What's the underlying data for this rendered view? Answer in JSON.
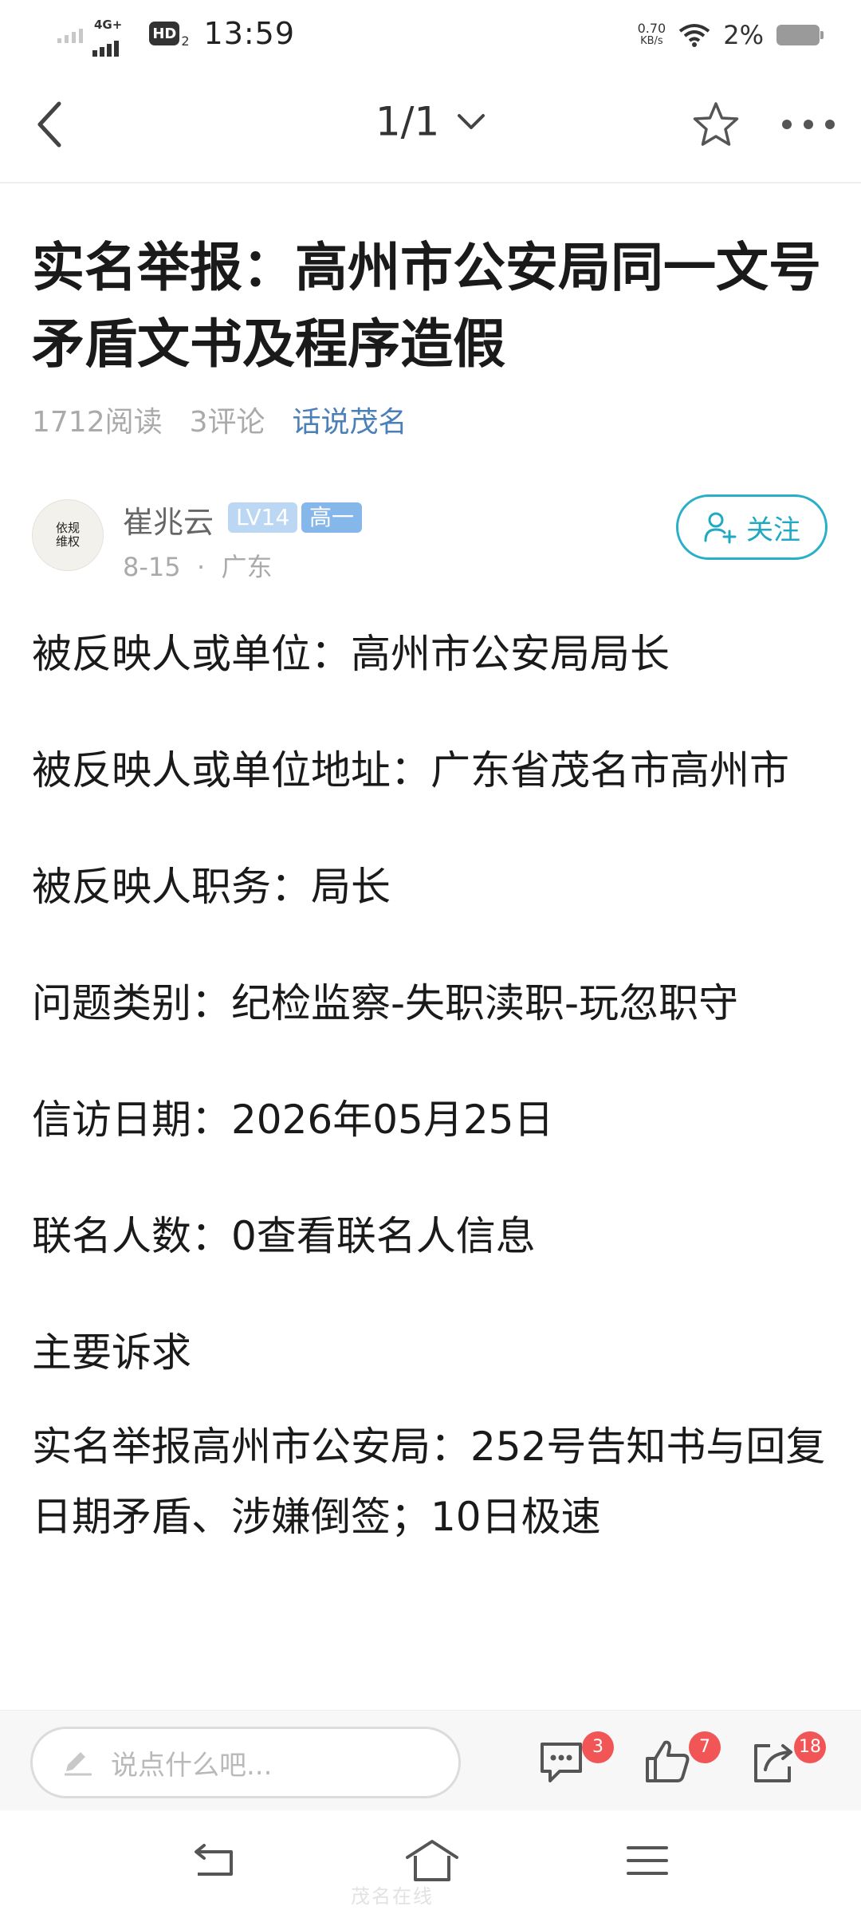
{
  "status_bar": {
    "network": "4G+",
    "hd": "HD",
    "hd_sub": "2",
    "time": "13:59",
    "speed_value": "0.70",
    "speed_unit": "KB/s",
    "battery": "2%"
  },
  "nav": {
    "page_indicator": "1/1"
  },
  "article": {
    "title": "实名举报：高州市公安局同一文号矛盾文书及程序造假",
    "reads": "1712阅读",
    "comments": "3评论",
    "forum": "话说茂名"
  },
  "author": {
    "avatar_text": "依规维权",
    "name": "崔兆云",
    "level": "LV14",
    "grade": "高一",
    "date_location": "8-15  ·  广东",
    "follow_label": "关注"
  },
  "content": {
    "p1": "被反映人或单位：高州市公安局局长",
    "p2": "被反映人或单位地址：广东省茂名市高州市",
    "p3": "被反映人职务：局长",
    "p4": "问题类别：纪检监察-失职渎职-玩忽职守",
    "p5": "信访日期：2026年05月25日",
    "p6": "联名人数：0查看联名人信息",
    "p7": "主要诉求",
    "p8": "实名举报高州市公安局：252号告知书与回复日期矛盾、涉嫌倒签；10日极速"
  },
  "comment_bar": {
    "placeholder": "说点什么吧...",
    "comment_count": "3",
    "like_count": "7",
    "share_count": "18"
  },
  "watermark": "茂名在线"
}
